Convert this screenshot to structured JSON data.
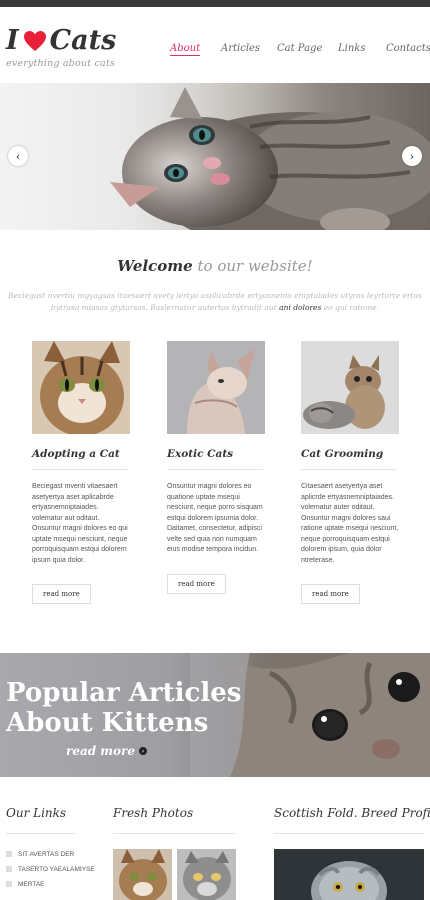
{
  "logo": {
    "word1": "I",
    "word2": "Cats",
    "tagline": "everything about cats"
  },
  "nav": {
    "items": [
      "About",
      "Articles",
      "Cat Page",
      "Links",
      "Contacts"
    ],
    "active": "About"
  },
  "slider": {
    "prev_icon": "chevron-left-icon",
    "next_icon": "chevron-right-icon",
    "prev_glyph": "‹",
    "next_glyph": "›"
  },
  "welcome": {
    "bold": "Welcome",
    "rest": "to our website!"
  },
  "intro": {
    "text_before": "Beciegast nvertiu mgyagsas itaesaert avety lertya asplicabrde ertyasnemo eniptalades utyras leyrtorte ertas bytrasa miasas gtytarsas. Baslernatur autertas bytradit aut",
    "link": "ani dolores",
    "text_after": "eo qui ratione."
  },
  "columns": [
    {
      "title": "Adopting a Cat",
      "text": "Beciegast mventi vitaesaert asetyertya aset aplicabrde ertyasnemniptaiades. volematur aut oditaut. Onsuntur magni dolores eo qui uptate msequi nesciunt, neque porroquisquam estqui dolorem ipsum quia dolor.",
      "button": "read more"
    },
    {
      "title": "Exotic Cats",
      "text": "Onsuntur magni dolores eo quatione uptate msequi nesciunt, neque porro sisquam estqui dolorem ipsumia dolor. Daitamet, consectetur, adipisci velte sed quia non numquam eius modise tempora incidun.",
      "button": "read more"
    },
    {
      "title": "Cat Grooming",
      "text": "Citaesaert asetyertya aset aplicrde ertyasnemniptaiades. volematur auter oditaut. Onsuntur magni dolores saui ratione uptate msequi nesciunt, neque porroquisquam estqui dolorem ipsum, quia dolor ntreterase.",
      "button": "read more"
    }
  ],
  "banner": {
    "line1": "Popular Articles",
    "line2": "About Kittens",
    "more": "read more",
    "more_icon": "arrow-right-icon",
    "more_glyph": "›"
  },
  "footer": {
    "links_title": "Our Links",
    "links": [
      "SIT AVERTAS DER",
      "TASERTO YAEALAMIYSE",
      "MERTAE"
    ],
    "photos_title": "Fresh Photos",
    "breed_title": "Scottish Fold. Breed Profile"
  },
  "colors": {
    "accent": "#e0306a",
    "heart": "#e8203a",
    "topbar": "#3a3a3a"
  }
}
